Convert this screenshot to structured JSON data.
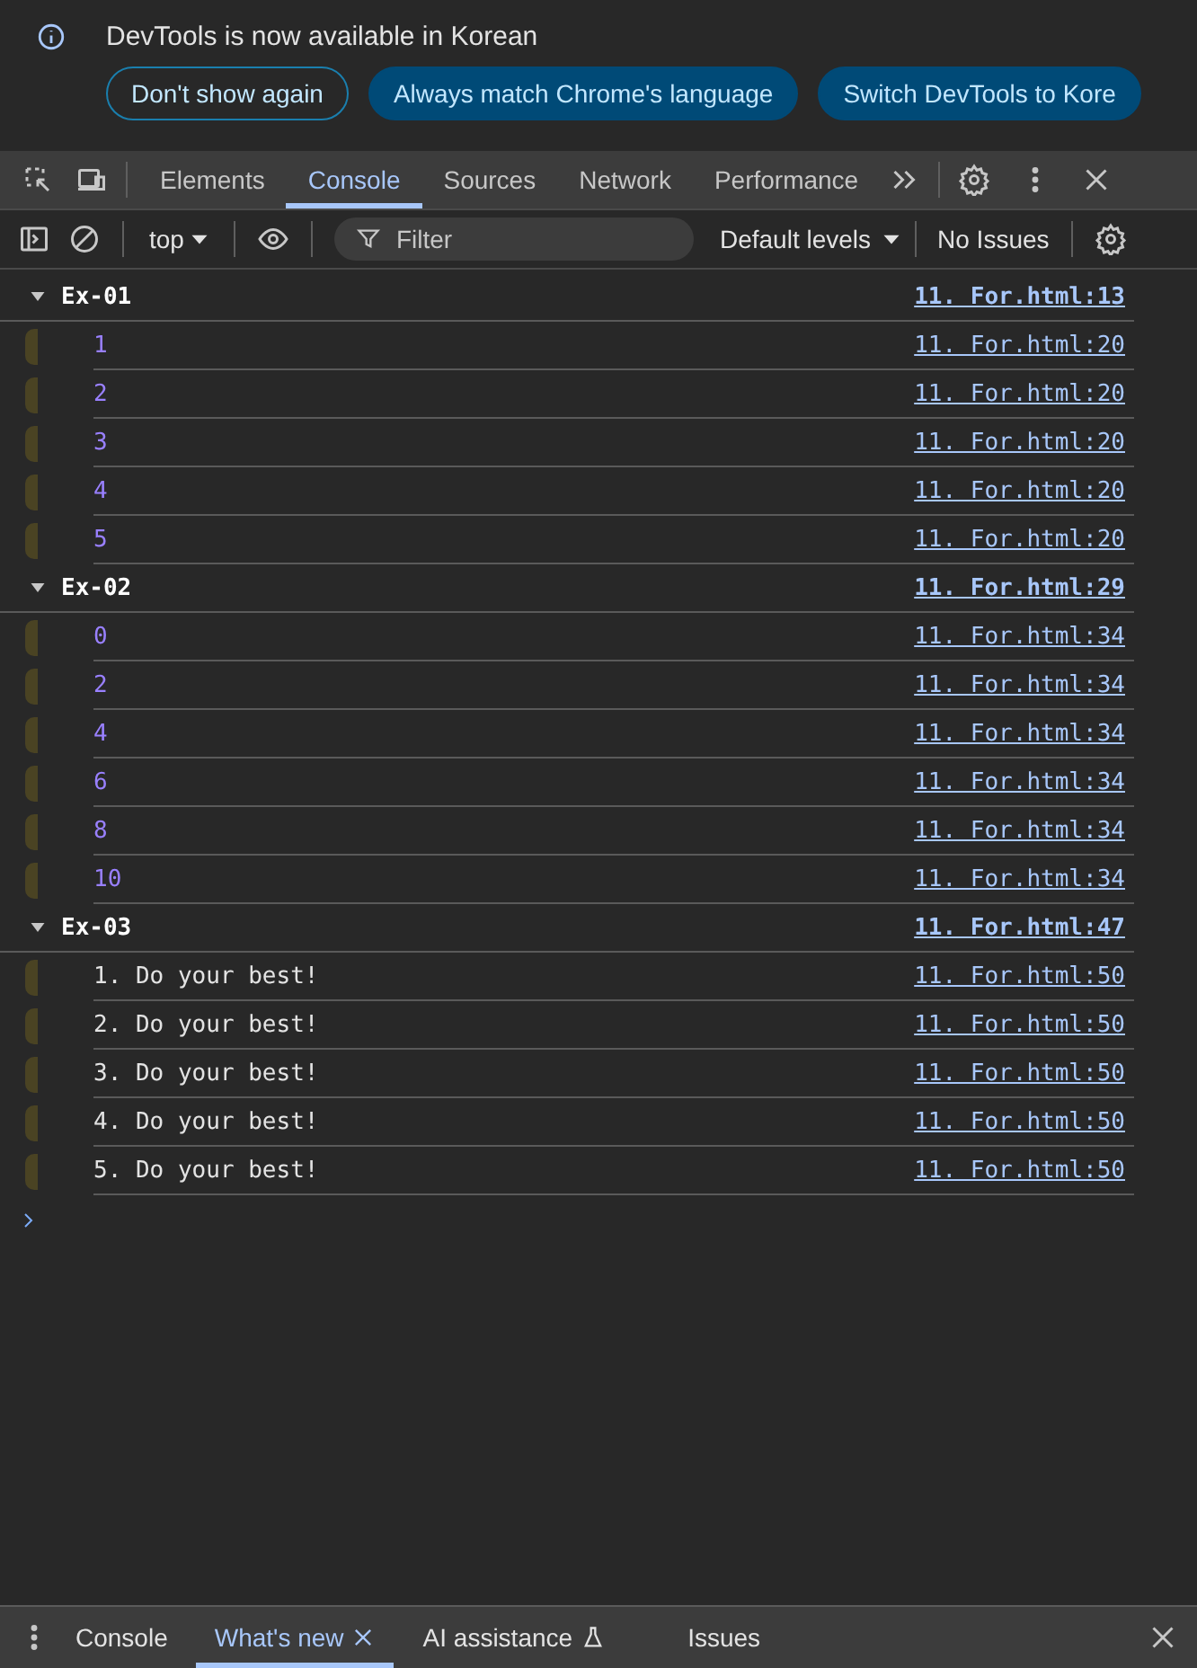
{
  "infobar": {
    "message": "DevTools is now available in Korean",
    "buttons": [
      {
        "label": "Don't show again",
        "kind": "outline"
      },
      {
        "label": "Always match Chrome's language",
        "kind": "filled"
      },
      {
        "label": "Switch DevTools to Kore",
        "kind": "filled"
      }
    ]
  },
  "tabs": [
    {
      "label": "Elements",
      "selected": false
    },
    {
      "label": "Console",
      "selected": true
    },
    {
      "label": "Sources",
      "selected": false
    },
    {
      "label": "Network",
      "selected": false
    },
    {
      "label": "Performance",
      "selected": false
    }
  ],
  "toolbar": {
    "context": "top",
    "filter_placeholder": "Filter",
    "levels": "Default levels",
    "issues": "No Issues"
  },
  "groups": [
    {
      "title": "Ex-01",
      "source": "11. For.html:13",
      "expanded": true,
      "messages": [
        {
          "text": "1",
          "kind": "number",
          "source": "11. For.html:20"
        },
        {
          "text": "2",
          "kind": "number",
          "source": "11. For.html:20"
        },
        {
          "text": "3",
          "kind": "number",
          "source": "11. For.html:20"
        },
        {
          "text": "4",
          "kind": "number",
          "source": "11. For.html:20"
        },
        {
          "text": "5",
          "kind": "number",
          "source": "11. For.html:20"
        }
      ]
    },
    {
      "title": "Ex-02",
      "source": "11. For.html:29",
      "expanded": true,
      "messages": [
        {
          "text": "0",
          "kind": "number",
          "source": "11. For.html:34"
        },
        {
          "text": "2",
          "kind": "number",
          "source": "11. For.html:34"
        },
        {
          "text": "4",
          "kind": "number",
          "source": "11. For.html:34"
        },
        {
          "text": "6",
          "kind": "number",
          "source": "11. For.html:34"
        },
        {
          "text": "8",
          "kind": "number",
          "source": "11. For.html:34"
        },
        {
          "text": "10",
          "kind": "number",
          "source": "11. For.html:34"
        }
      ]
    },
    {
      "title": "Ex-03",
      "source": "11. For.html:47",
      "expanded": true,
      "messages": [
        {
          "text": "1. Do your best!",
          "kind": "string",
          "source": "11. For.html:50"
        },
        {
          "text": "2. Do your best!",
          "kind": "string",
          "source": "11. For.html:50"
        },
        {
          "text": "3. Do your best!",
          "kind": "string",
          "source": "11. For.html:50"
        },
        {
          "text": "4. Do your best!",
          "kind": "string",
          "source": "11. For.html:50"
        },
        {
          "text": "5. Do your best!",
          "kind": "string",
          "source": "11. For.html:50"
        }
      ]
    }
  ],
  "drawer_tabs": [
    {
      "label": "Console",
      "selected": false,
      "closable": false,
      "experimental": false
    },
    {
      "label": "What's new",
      "selected": true,
      "closable": true,
      "experimental": false
    },
    {
      "label": "AI assistance",
      "selected": false,
      "closable": false,
      "experimental": true
    },
    {
      "label": "Issues",
      "selected": false,
      "closable": false,
      "experimental": false
    }
  ]
}
